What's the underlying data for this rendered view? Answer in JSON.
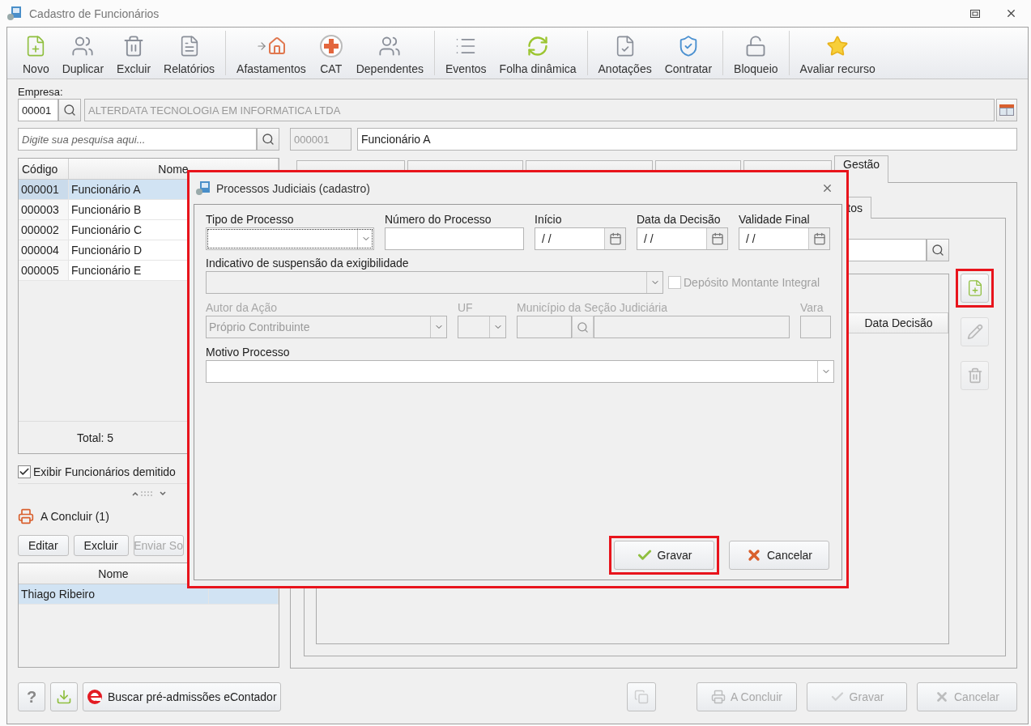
{
  "window": {
    "title": "Cadastro de Funcionários"
  },
  "toolbar": [
    {
      "items": [
        {
          "label": "Novo"
        },
        {
          "label": "Duplicar"
        },
        {
          "label": "Excluir"
        },
        {
          "label": "Relatórios"
        }
      ]
    },
    {
      "items": [
        {
          "label": "Afastamentos"
        },
        {
          "label": "CAT"
        },
        {
          "label": "Dependentes"
        }
      ]
    },
    {
      "items": [
        {
          "label": "Eventos"
        },
        {
          "label": "Folha dinâmica"
        }
      ]
    },
    {
      "items": [
        {
          "label": "Anotações"
        },
        {
          "label": "Contratar"
        }
      ]
    },
    {
      "items": [
        {
          "label": "Bloqueio"
        }
      ]
    },
    {
      "items": [
        {
          "label": "Avaliar recurso"
        }
      ]
    }
  ],
  "company": {
    "label": "Empresa:",
    "code": "00001",
    "name": "ALTERDATA TECNOLOGIA EM INFORMATICA LTDA"
  },
  "search": {
    "placeholder": "Digite sua pesquisa aqui..."
  },
  "employee": {
    "code": "000001",
    "name": "Funcionário A"
  },
  "employees_table": {
    "columns": [
      "Código",
      "Nome"
    ],
    "rows": [
      {
        "code": "000001",
        "name": "Funcionário A",
        "selected": true
      },
      {
        "code": "000003",
        "name": "Funcionário B",
        "selected": false
      },
      {
        "code": "000002",
        "name": "Funcionário C",
        "selected": false
      },
      {
        "code": "000004",
        "name": "Funcionário D",
        "selected": false
      },
      {
        "code": "000005",
        "name": "Funcionário E",
        "selected": false
      }
    ],
    "footer": "Total: 5"
  },
  "show_dismissed": {
    "label": "Exibir Funcionários demitido",
    "checked": true
  },
  "pending": {
    "title": "A Concluir (1)",
    "buttons": [
      {
        "label": "Editar",
        "disabled": false
      },
      {
        "label": "Excluir",
        "disabled": false
      },
      {
        "label": "Enviar So",
        "disabled": true
      }
    ],
    "columns": [
      "Nome"
    ],
    "rows": [
      {
        "name": "Thiago Ribeiro",
        "selected": true
      }
    ]
  },
  "tabs": [
    {
      "selected": false
    },
    {
      "selected": false
    },
    {
      "selected": false
    },
    {
      "selected": false
    },
    {
      "selected": false
    },
    {
      "label": "Gestão",
      "selected": true
    }
  ],
  "subtab": {
    "label": "tos",
    "selected": true
  },
  "process_table": {
    "columns": [
      "Data Decisão"
    ]
  },
  "side_buttons": [
    {
      "kind": "new",
      "disabled": false,
      "highlighted": true
    },
    {
      "kind": "edit",
      "disabled": true,
      "highlighted": false
    },
    {
      "kind": "delete",
      "disabled": true,
      "highlighted": false
    }
  ],
  "bottom_left": {
    "help": "?",
    "econtador": "Buscar pré-admissões eContador"
  },
  "bottom_right": [
    {
      "kind": "copy",
      "disabled": true
    },
    {
      "kind": "conclude",
      "label": "A Concluir",
      "disabled": true
    },
    {
      "kind": "save",
      "label": "Gravar",
      "disabled": true
    },
    {
      "kind": "cancel",
      "label": "Cancelar",
      "disabled": true
    }
  ],
  "dialog": {
    "title": "Processos Judiciais (cadastro)",
    "highlighted": true,
    "process_type": {
      "label": "Tipo de Processo"
    },
    "process_number": {
      "label": "Número do Processo"
    },
    "dates": [
      {
        "label": "Início",
        "value": "/ /"
      },
      {
        "label": "Data da Decisão",
        "value": "/ /"
      },
      {
        "label": "Validade Final",
        "value": "/ /"
      }
    ],
    "suspension": {
      "label": "Indicativo de suspensão da exigibilidade"
    },
    "deposit": {
      "label": "Depósito Montante Integral",
      "checked": false,
      "disabled": true
    },
    "author": {
      "label": "Autor da Ação",
      "value": "Próprio Contribuinte",
      "disabled": true
    },
    "uf": {
      "label": "UF",
      "disabled": true
    },
    "municipality": {
      "label": "Município da Seção Judiciária",
      "disabled": true
    },
    "court": {
      "label": "Vara",
      "disabled": true
    },
    "reason": {
      "label": "Motivo Processo"
    },
    "buttons": [
      {
        "kind": "save",
        "label": "Gravar",
        "highlighted": true
      },
      {
        "kind": "cancel",
        "label": "Cancelar",
        "highlighted": false
      }
    ]
  }
}
